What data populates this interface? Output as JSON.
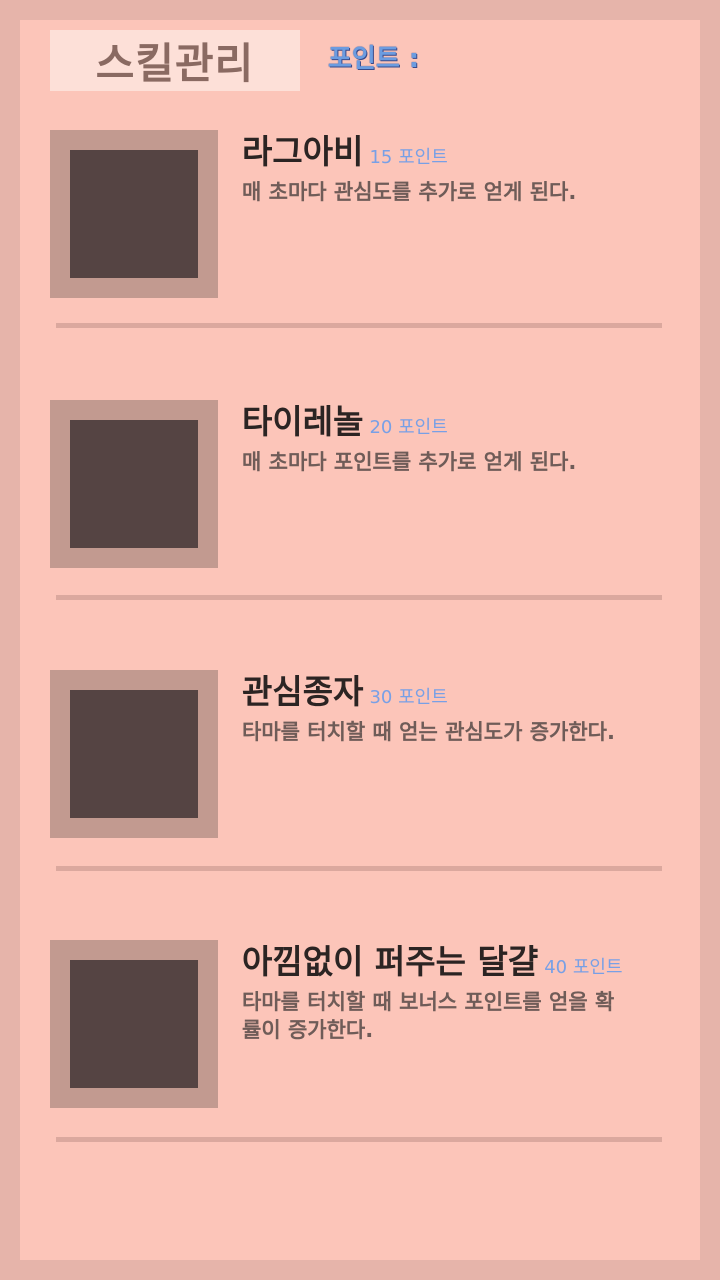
{
  "header": {
    "title": "스킬관리",
    "points_label": "포인트 :"
  },
  "skills": [
    {
      "name": "라그아비",
      "cost": "15 포인트",
      "desc": "매 초마다 관심도를 추가로 얻게 된다."
    },
    {
      "name": "타이레놀",
      "cost": "20 포인트",
      "desc": "매 초마다 포인트를 추가로 얻게 된다."
    },
    {
      "name": "관심종자",
      "cost": "30 포인트",
      "desc": "타마를 터치할 때 얻는 관심도가 증가한다."
    },
    {
      "name": "아낌없이 퍼주는 달걀",
      "cost": "40 포인트",
      "desc": "타마를 터치할 때 보너스 포인트를 얻을 확률이 증가한다."
    }
  ]
}
